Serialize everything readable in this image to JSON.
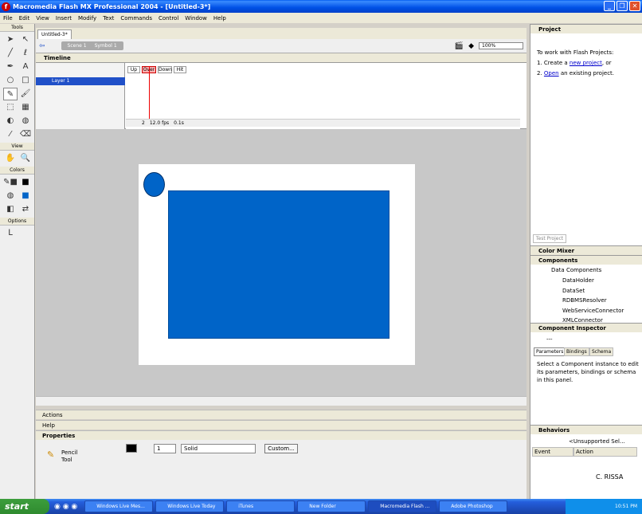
{
  "window": {
    "title": "Macromedia Flash MX Professional 2004 - [Untitled-3*]",
    "minimize": "_",
    "restore": "❐",
    "close": "✕"
  },
  "menu": [
    "File",
    "Edit",
    "View",
    "Insert",
    "Modify",
    "Text",
    "Commands",
    "Control",
    "Window",
    "Help"
  ],
  "tools": {
    "header": "Tools",
    "view_header": "View",
    "colors_header": "Colors",
    "options_header": "Options"
  },
  "document": {
    "tab": "Untitled-3*",
    "scene": "Scene 1",
    "symbol": "Symbol 1",
    "zoom": "100%"
  },
  "timeline": {
    "header": "Timeline",
    "layer_name": "Layer 1",
    "frame_labels": [
      "Up",
      "Over",
      "Down",
      "Hit"
    ],
    "current_frame": "2",
    "fps": "12.0 fps",
    "time": "0.1s"
  },
  "panels": {
    "actions": "Actions",
    "help": "Help",
    "properties": "Properties"
  },
  "properties": {
    "tool_name_line1": "Pencil",
    "tool_name_line2": "Tool",
    "stroke_height": "1",
    "stroke_style": "Solid",
    "custom_button": "Custom..."
  },
  "right_panel": {
    "project_header": "Project",
    "project_intro": "To work with Flash Projects:",
    "step1_prefix": "1. Create a ",
    "step1_link": "new project",
    "step1_suffix": ", or",
    "step2_prefix": "2. ",
    "step2_link": "Open",
    "step2_suffix": " an existing project.",
    "test_project_button": "Test Project",
    "color_mixer_header": "Color Mixer",
    "components_header": "Components",
    "component_group": "Data Components",
    "components": [
      "DataHolder",
      "DataSet",
      "RDBMSResolver",
      "WebServiceConnector",
      "XMLConnector"
    ],
    "inspector_header": "Component Inspector",
    "inspector_value": "---",
    "inspector_tabs": [
      "Parameters",
      "Bindings",
      "Schema"
    ],
    "inspector_message": "Select a Component instance to edit its parameters, bindings or schema in this panel.",
    "behaviors_header": "Behaviors",
    "behaviors_selection": "<Unsupported Sel...",
    "behaviors_columns": [
      "Event",
      "Action"
    ]
  },
  "watermark": "C. RISSA",
  "taskbar": {
    "start": "start",
    "tasks": [
      "Windows Live Mes...",
      "Windows Live Today",
      "iTunes",
      "New Folder",
      "Macromedia Flash ...",
      "Adobe Photoshop"
    ],
    "clock": "10:51 PM"
  },
  "colors": {
    "shape_blue": "#0064C8",
    "titlebar_blue": "#0058EE",
    "playhead_red": "#E00000",
    "start_green": "#3C9E3C"
  }
}
